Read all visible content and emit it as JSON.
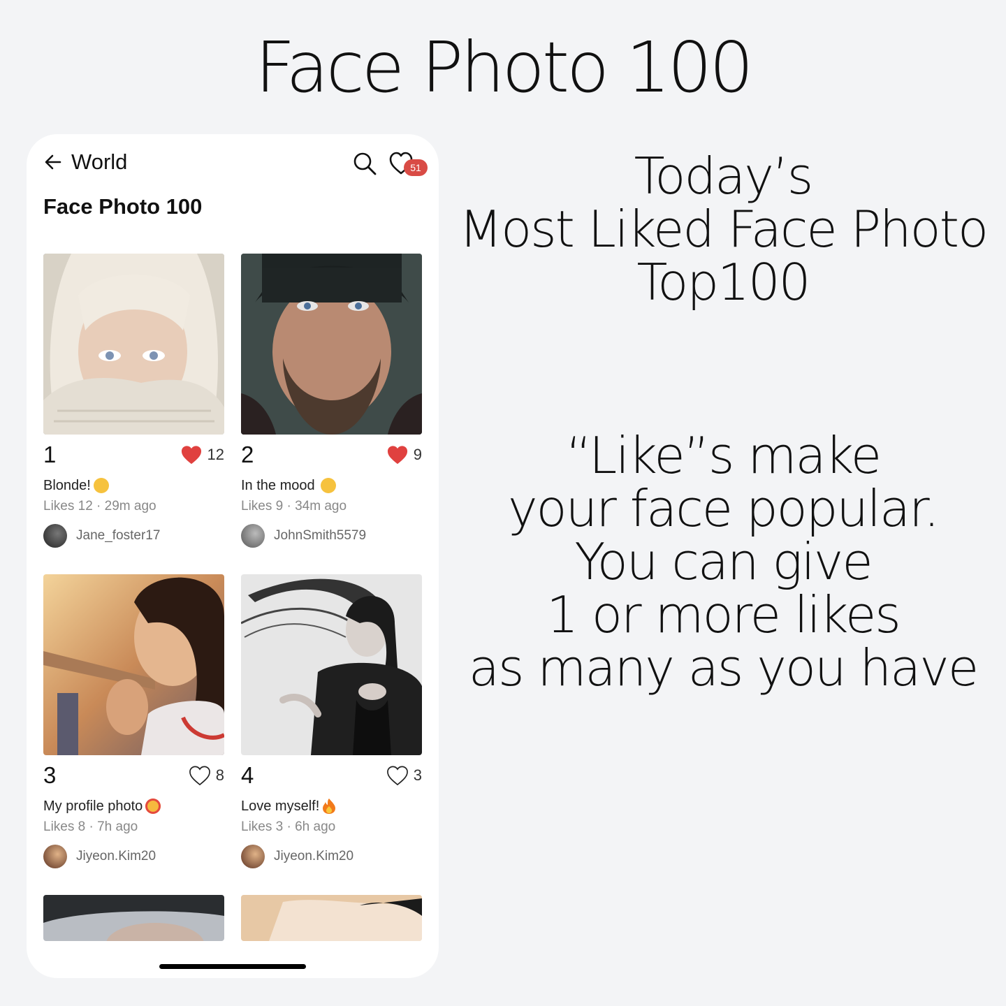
{
  "headline": "Face Photo 100",
  "topbar": {
    "back_label": "World",
    "notification_count": "51"
  },
  "page_title": "Face Photo 100",
  "cards": [
    {
      "rank": "1",
      "likes": "12",
      "liked": true,
      "caption": "Blonde!",
      "emoji": "face-emoji",
      "meta": "Likes 12 · 29m ago",
      "user": "Jane_foster17"
    },
    {
      "rank": "2",
      "likes": "9",
      "liked": true,
      "caption": "In the mood",
      "emoji": "crying-face-emoji",
      "meta": "Likes 9 · 34m ago",
      "user": "JohnSmith5579"
    },
    {
      "rank": "3",
      "likes": "8",
      "liked": false,
      "caption": "My profile photo",
      "emoji": "smiling-hearts-emoji",
      "meta": "Likes 8 · 7h ago",
      "user": "Jiyeon.Kim20"
    },
    {
      "rank": "4",
      "likes": "3",
      "liked": false,
      "caption": "Love myself!",
      "emoji": "fire-emoji",
      "meta": "Likes 3 · 6h ago",
      "user": "Jiyeon.Kim20"
    }
  ],
  "right_text": {
    "block1": [
      "Today’s",
      "Most Liked Face Photo",
      "Top100"
    ],
    "block2": [
      "“Like”s make",
      "your face popular.",
      "You can give",
      "1 or more likes",
      "as many as you have"
    ]
  },
  "colors": {
    "like_red": "#e0413f",
    "badge_red": "#d94b45",
    "background": "#f3f4f6"
  }
}
